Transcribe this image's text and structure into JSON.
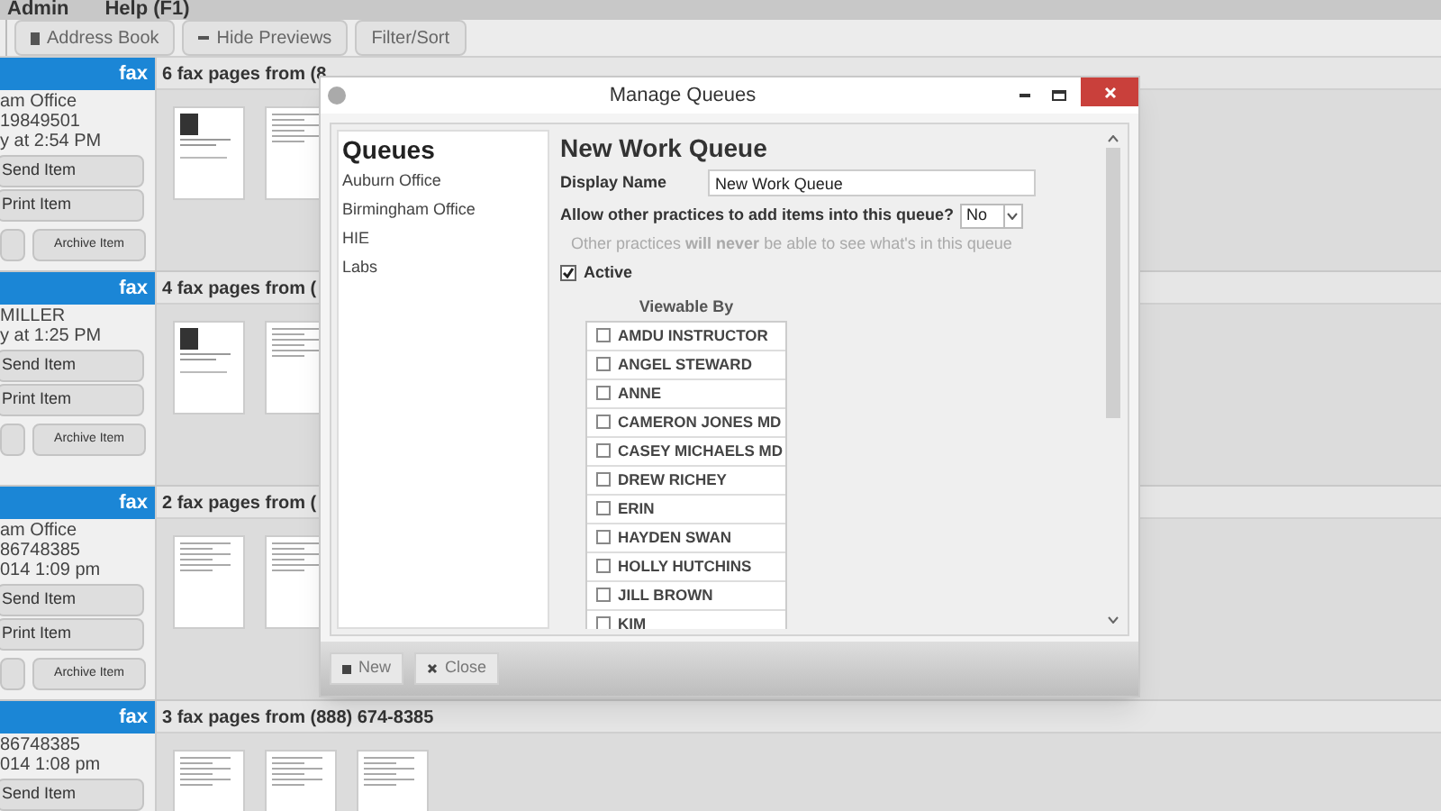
{
  "menu": [
    "Admin",
    "Help (F1)"
  ],
  "toolbar": [
    {
      "label": "Address Book",
      "kind": "book"
    },
    {
      "label": "Hide Previews",
      "kind": "minus"
    },
    {
      "label": "Filter/Sort",
      "kind": "plain"
    }
  ],
  "fax_items": [
    {
      "tag": "fax",
      "lines": [
        "am Office",
        "19849501",
        "y at 2:54 PM"
      ],
      "buttons": [
        "Send Item",
        "Print Item"
      ],
      "archive": "Archive Item",
      "title": "6 fax pages from (8",
      "thumbnails": [
        {
          "kind": "letterhead"
        },
        {
          "kind": "form"
        }
      ]
    },
    {
      "tag": "fax",
      "lines": [
        "MILLER",
        "y at 1:25 PM"
      ],
      "buttons": [
        "Send Item",
        "Print Item"
      ],
      "archive": "Archive Item",
      "title": "4 fax pages from (",
      "thumbnails": [
        {
          "kind": "letterhead"
        },
        {
          "kind": "form"
        }
      ]
    },
    {
      "tag": "fax",
      "lines": [
        "am Office",
        "86748385",
        "014 1:09 pm"
      ],
      "buttons": [
        "Send Item",
        "Print Item"
      ],
      "archive": "Archive Item",
      "title": "2 fax pages from (",
      "thumbnails": [
        {
          "kind": "form"
        },
        {
          "kind": "form"
        }
      ]
    },
    {
      "tag": "fax",
      "lines": [
        "86748385",
        "014 1:08 pm"
      ],
      "buttons": [
        "Send Item"
      ],
      "title": "3 fax pages from (888) 674-8385",
      "thumbnails": [
        {
          "kind": "form"
        },
        {
          "kind": "form"
        },
        {
          "kind": "form"
        }
      ]
    }
  ],
  "dialog": {
    "title": "Manage Queues",
    "queues_heading": "Queues",
    "queues": [
      {
        "label": "Auburn Office",
        "selected": false
      },
      {
        "label": "Birmingham Office",
        "selected": false
      },
      {
        "label": "HIE",
        "selected": false
      },
      {
        "label": "Labs",
        "selected": false
      }
    ],
    "form_title": "New Work Queue",
    "display_name_label": "Display Name",
    "display_name_value": "New Work Queue",
    "allow_label": "Allow other practices to add items into this queue?",
    "allow_value": "No",
    "allow_hint": "Other practices **will never** be able to see what's in this queue",
    "active_label": "Active",
    "active_checked": true,
    "viewable_by_heading": "Viewable By",
    "viewers": [
      {
        "name": "AMDU INSTRUCTOR",
        "checked": false
      },
      {
        "name": "ANGEL STEWARD",
        "checked": false
      },
      {
        "name": "ANNE",
        "checked": false
      },
      {
        "name": "CAMERON JONES MD",
        "checked": false
      },
      {
        "name": "CASEY MICHAELS MD",
        "checked": false
      },
      {
        "name": "DREW RICHEY",
        "checked": false
      },
      {
        "name": "ERIN",
        "checked": false
      },
      {
        "name": "HAYDEN SWAN",
        "checked": false
      },
      {
        "name": "HOLLY HUTCHINS",
        "checked": false
      },
      {
        "name": "JILL BROWN",
        "checked": false
      },
      {
        "name": "KIM",
        "checked": false
      }
    ],
    "footer_buttons": [
      {
        "label": "New",
        "kind": "new"
      },
      {
        "label": "Close",
        "kind": "close"
      }
    ]
  }
}
